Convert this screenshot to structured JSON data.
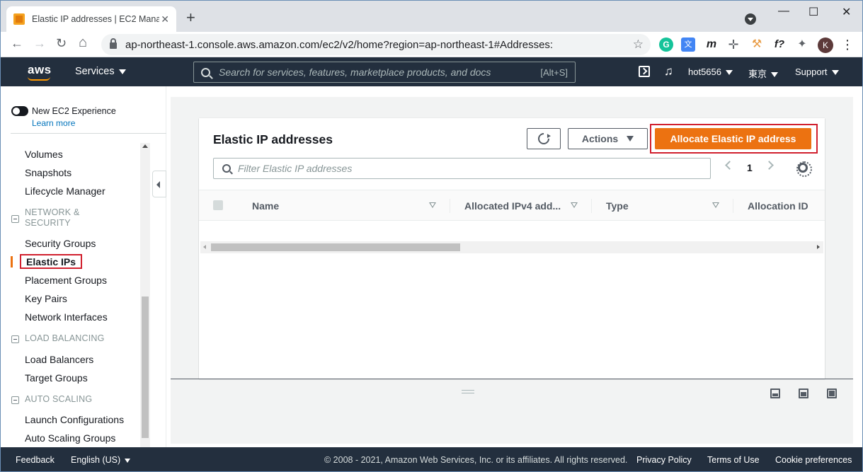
{
  "browser": {
    "tab_title": "Elastic IP addresses | EC2 Mana",
    "tab_close": "✕",
    "new_tab": "+",
    "url": "ap-northeast-1.console.aws.amazon.com/ec2/v2/home?region=ap-northeast-1#Addresses:",
    "window_controls": {
      "minimize": "—",
      "maximize": "☐",
      "close": "✕"
    },
    "extensions": {
      "grammarly": "G",
      "translate": "文",
      "m": "m",
      "f": "f?",
      "menu": "⋮"
    },
    "avatar_letter": "K",
    "nav": {
      "back": "←",
      "forward": "→",
      "reload": "↻",
      "home": "⌂",
      "star": "☆"
    }
  },
  "aws_nav": {
    "logo": "aws",
    "services": "Services",
    "search_placeholder": "Search for services, features, marketplace products, and docs",
    "search_shortcut": "[Alt+S]",
    "bell": "🔔",
    "account": "hot5656",
    "region": "東京",
    "support": "Support"
  },
  "sidebar": {
    "new_experience": "New EC2 Experience",
    "learn_more": "Learn more",
    "items_top": [
      "Volumes",
      "Snapshots",
      "Lifecycle Manager"
    ],
    "section_network": "NETWORK & SECURITY",
    "network_items": [
      "Security Groups",
      "Elastic IPs",
      "Placement Groups",
      "Key Pairs",
      "Network Interfaces"
    ],
    "section_lb": "LOAD BALANCING",
    "lb_items": [
      "Load Balancers",
      "Target Groups"
    ],
    "section_as": "AUTO SCALING",
    "as_items": [
      "Launch Configurations",
      "Auto Scaling Groups"
    ]
  },
  "main": {
    "title": "Elastic IP addresses",
    "actions_label": "Actions",
    "allocate_label": "Allocate Elastic IP address",
    "filter_placeholder": "Filter Elastic IP addresses",
    "page_number": "1",
    "columns": [
      "Name",
      "Allocated IPv4 add...",
      "Type",
      "Allocation ID"
    ]
  },
  "footer": {
    "feedback": "Feedback",
    "language": "English (US)",
    "copyright": "© 2008 - 2021, Amazon Web Services, Inc. or its affiliates. All rights reserved.",
    "privacy": "Privacy Policy",
    "terms": "Terms of Use",
    "cookies": "Cookie preferences"
  },
  "colors": {
    "aws_nav_bg": "#232f3e",
    "primary_orange": "#ec7211",
    "highlight_red": "#d1202e",
    "link_blue": "#0073bb"
  }
}
